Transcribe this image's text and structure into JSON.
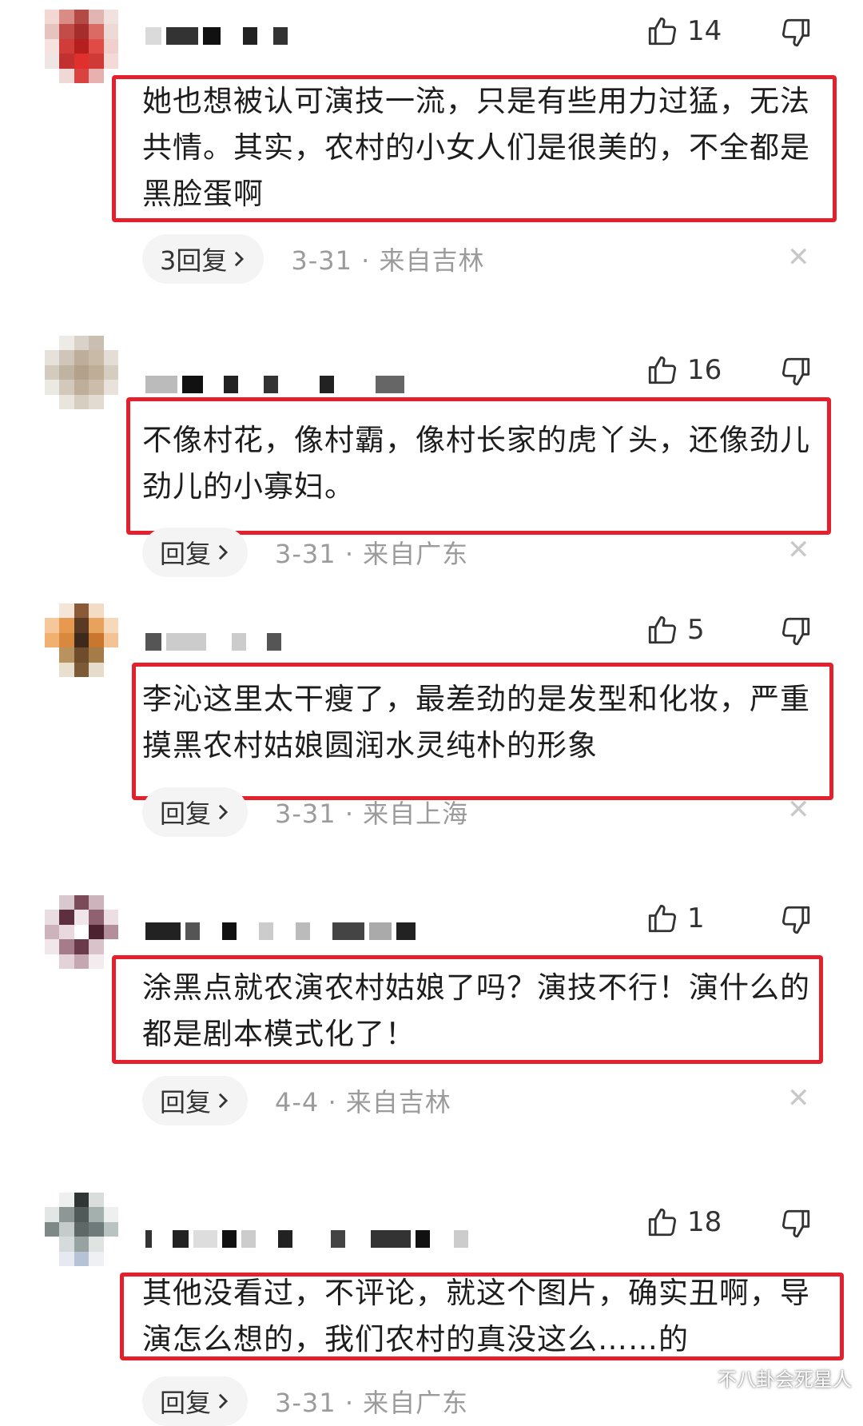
{
  "comments": [
    {
      "likes": "14",
      "text": "她也想被认可演技一流，只是有些用力过猛，无法共情。其实，农村的小女人们是很美的，不全都是黑脸蛋啊",
      "reply_label": "3回复",
      "date": "3-31",
      "location": "来自吉林",
      "avatar_colors": [
        "#f3d7d2",
        "#d98b86",
        "#b34a45",
        "#e1b6b2",
        "#f1e1df",
        "#e5c4c0",
        "#c24c48",
        "#a62d2b",
        "#d96a64",
        "#eddad7",
        "#f6e2df",
        "#d23c38",
        "#b51f1e",
        "#e14b46",
        "#f0cfcc",
        "#efe5e4",
        "#c0312f",
        "#e02f2c",
        "#cf3a36",
        "#f3dad7",
        "#ffffff",
        "#f0d8d6",
        "#d9423e",
        "#e6b1ae",
        "#ffffff"
      ]
    },
    {
      "likes": "16",
      "text": "不像村花，像村霸，像村长家的虎丫头，还像劲儿劲儿的小寡妇。",
      "reply_label": "回复",
      "date": "3-31",
      "location": "来自广东",
      "avatar_colors": [
        "#ffffff",
        "#eeeae6",
        "#d8d2c9",
        "#c9beb1",
        "#ffffff",
        "#e6e1da",
        "#cfc5b9",
        "#bdae9c",
        "#c8baa7",
        "#e3ddd5",
        "#d4cbbf",
        "#c1b3a1",
        "#b3a18b",
        "#bfae97",
        "#d6cdc1",
        "#ece8e2",
        "#d2c8bb",
        "#bfae99",
        "#cbbda9",
        "#e8e2db",
        "#ffffff",
        "#e9e4dd",
        "#d7cec2",
        "#e2dbd1",
        "#ffffff"
      ]
    },
    {
      "likes": "5",
      "text": "李沁这里太干瘦了，最差劲的是发型和化妆，严重摸黑农村姑娘圆润水灵纯朴的形象",
      "reply_label": "回复",
      "date": "3-31",
      "location": "来自上海",
      "avatar_colors": [
        "#ffffff",
        "#f3e5d7",
        "#8a5a38",
        "#f2dcc6",
        "#ffffff",
        "#f5c79a",
        "#e79a4f",
        "#5b3a25",
        "#e7a25c",
        "#f6d9bb",
        "#f0b070",
        "#d9893d",
        "#3e2a1d",
        "#c9762f",
        "#f3c393",
        "#ffffff",
        "#b8935f",
        "#6e4c2c",
        "#a57b47",
        "#ffffff",
        "#ffffff",
        "#e9dfcf",
        "#7d5a36",
        "#e6dccb",
        "#ffffff"
      ]
    },
    {
      "likes": "1",
      "text": "涂黑点就农演农村姑娘了吗？演技不行！演什么的都是剧本模式化了！",
      "reply_label": "回复",
      "date": "4-4",
      "location": "来自吉林",
      "avatar_colors": [
        "#ffffff",
        "#d9c9cf",
        "#7c4b5a",
        "#cdb4bc",
        "#ffffff",
        "#e9dde1",
        "#5e2f3e",
        "#f0e6e9",
        "#8f6171",
        "#ecdfe3",
        "#cdb3bb",
        "#e8d9de",
        "#ffffff",
        "#4c2231",
        "#b58e9b",
        "#f1e7ea",
        "#a67b8a",
        "#6a3a4a",
        "#d8c3ca",
        "#ffffff",
        "#ffffff",
        "#e3d3d9",
        "#c4a7b1",
        "#f3ebee",
        "#ffffff"
      ]
    },
    {
      "likes": "18",
      "text": "其他没看过，不评论，就这个图片，确实丑啊，导演怎么想的，我们农村的真没这么……的",
      "reply_label": "回复",
      "date": "3-31",
      "location": "来自广东",
      "avatar_colors": [
        "#ffffff",
        "#eef0ef",
        "#2f3535",
        "#d9dedd",
        "#ffffff",
        "#e2e6e5",
        "#8c9796",
        "#4f5a59",
        "#a4b0ae",
        "#edf0ef",
        "#7d8887",
        "#c3cccb",
        "#5d6867",
        "#6f7b7a",
        "#b9c3c1",
        "#ffffff",
        "#d5dbda",
        "#97a3a1",
        "#dfe4e3",
        "#ffffff",
        "#ffffff",
        "#e6eaf0",
        "#b8c2d6",
        "#eef0f4",
        "#ffffff"
      ]
    }
  ],
  "watermark": "不八卦会死星人",
  "icons": {
    "like": "thumbs-up-icon",
    "dislike": "thumbs-down-icon",
    "reply_chevron": "chevron-right-icon",
    "close": "close-icon"
  },
  "colors": {
    "highlight": "#e3202b",
    "meta": "#9b9b9b"
  }
}
